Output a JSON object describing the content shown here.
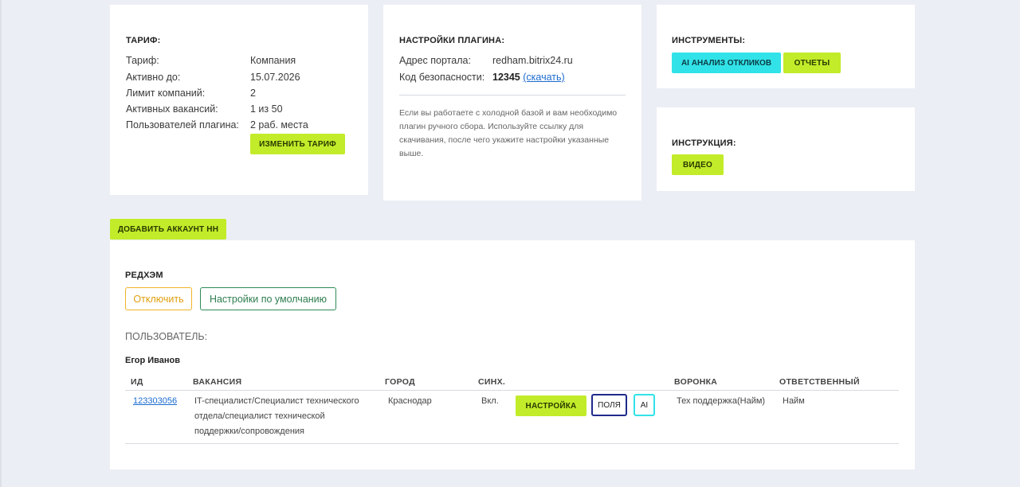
{
  "tariff": {
    "title": "ТАРИФ:",
    "rows": [
      {
        "label": "Тариф:",
        "value": "Компания"
      },
      {
        "label": "Активно до:",
        "value": "15.07.2026"
      },
      {
        "label": "Лимит компаний:",
        "value": "2"
      },
      {
        "label": "Активных вакансий:",
        "value": "1 из 50"
      },
      {
        "label": "Пользователей плагина:",
        "value": "2 раб. места"
      }
    ],
    "change_button": "ИЗМЕНИТЬ ТАРИФ"
  },
  "plugin": {
    "title": "НАСТРОЙКИ ПЛАГИНА:",
    "portal_label": "Адрес портала:",
    "portal_value": "redham.bitrix24.ru",
    "code_label": "Код безопасности:",
    "code_value": "12345",
    "download_link": "(скачать)",
    "description": "Если вы работаете с холодной базой и вам необходимо плагин ручного сбора. Используйте ссылку для скачивания, после чего укажите настройки указанные выше."
  },
  "tools": {
    "title": "ИНСТРУМЕНТЫ:",
    "ai_button": "AI АНАЛИЗ ОТКЛИКОВ",
    "reports_button": "ОТЧЕТЫ"
  },
  "instruction": {
    "title": "ИНСТРУКЦИЯ:",
    "video_button": "ВИДЕО"
  },
  "add_account_button": "ДОБАВИТЬ АККАУНТ HH",
  "account": {
    "name": "РЕДХЭМ",
    "disable_button": "Отключить",
    "defaults_button": "Настройки по умолчанию",
    "user_heading": "ПОЛЬЗОВАТЕЛЬ:",
    "user_name": "Егор Иванов",
    "columns": [
      "ИД",
      "ВАКАНСИЯ",
      "ГОРОД",
      "СИНХ.",
      "ВОРОНКА",
      "ОТВЕТСТВЕННЫЙ"
    ],
    "rows": [
      {
        "id": "123303056",
        "vacancy_lines": [
          "IT-специалист/Специалист технического",
          "отдела/специалист технической",
          "поддержки/сопровождения"
        ],
        "city": "Краснодар",
        "sync": "Вкл.",
        "settings_button": "НАСТРОЙКА",
        "fields_button": "ПОЛЯ",
        "ai_button": "AI",
        "funnel": "Тех поддержка(Найм)",
        "responsible": "Найм"
      }
    ]
  },
  "colors": {
    "lime": "#c2ec2a",
    "cyan": "#31e3e8",
    "warning": "#f0b429",
    "success": "#2e8b57",
    "navy": "#1f2a8c",
    "link": "#1a6bd0"
  }
}
